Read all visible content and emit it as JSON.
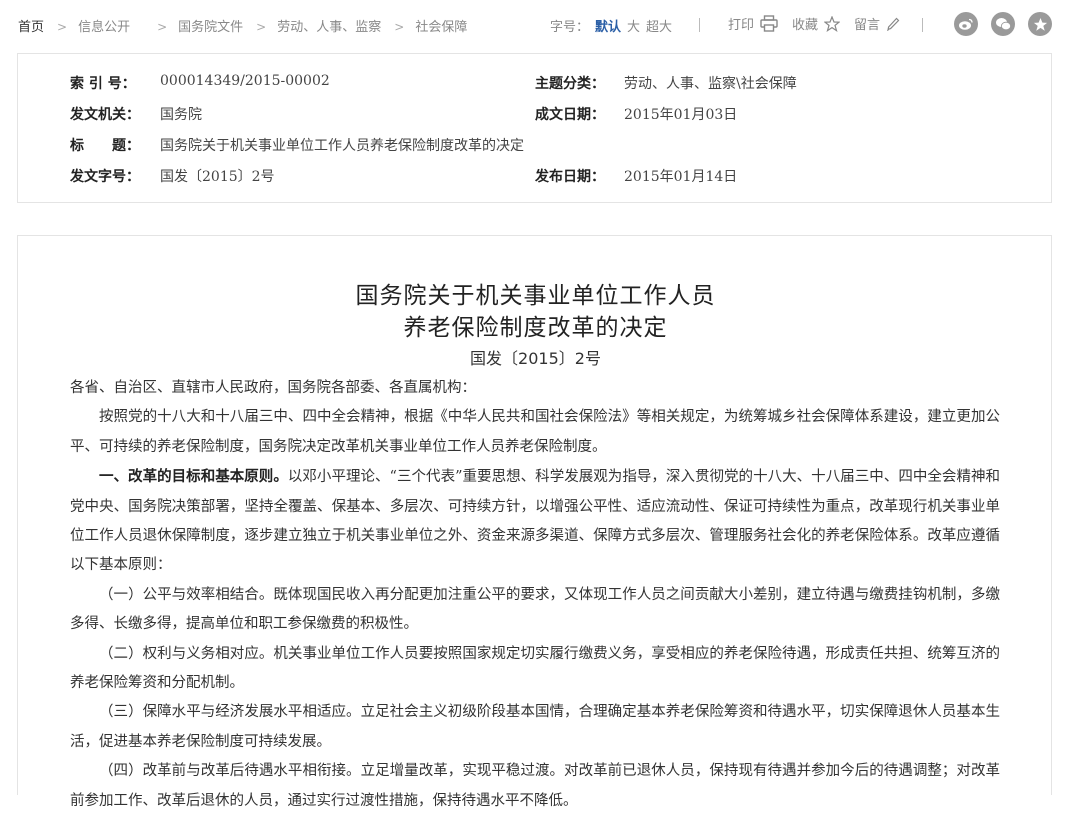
{
  "breadcrumb": {
    "home": "首页",
    "items": [
      "信息公开",
      "国务院文件",
      "劳动、人事、监察",
      "社会保障"
    ]
  },
  "font_size": {
    "label": "字号：",
    "options": [
      "默认",
      "大",
      "超大"
    ],
    "selected": "默认"
  },
  "tools": {
    "print": "打印",
    "favorite": "收藏",
    "comment": "留言"
  },
  "social_icons": [
    "weibo-icon",
    "wechat-icon",
    "star-share-icon"
  ],
  "info": {
    "index_label": "索 引 号：",
    "index_value": "000014349/2015-00002",
    "topic_label": "主题分类：",
    "topic_value": "劳动、人事、监察\\社会保障",
    "issuer_label": "发文机关：",
    "issuer_value": "国务院",
    "date_label": "成文日期：",
    "date_value": "2015年01月03日",
    "title_label": "标　　题：",
    "title_value": "国务院关于机关事业单位工作人员养老保险制度改革的决定",
    "docno_label": "发文字号：",
    "docno_value": "国发〔2015〕2号",
    "pubdate_label": "发布日期：",
    "pubdate_value": "2015年01月14日"
  },
  "article": {
    "title_line1": "国务院关于机关事业单位工作人员",
    "title_line2": "养老保险制度改革的决定",
    "doc_number": "国发〔2015〕2号",
    "salutation": "各省、自治区、直辖市人民政府，国务院各部委、各直属机构：",
    "p1": "按照党的十八大和十八届三中、四中全会精神，根据《中华人民共和国社会保险法》等相关规定，为统筹城乡社会保障体系建设，建立更加公平、可持续的养老保险制度，国务院决定改革机关事业单位工作人员养老保险制度。",
    "p2_head": "一、改革的目标和基本原则。",
    "p2_body": "以邓小平理论、“三个代表”重要思想、科学发展观为指导，深入贯彻党的十八大、十八届三中、四中全会精神和党中央、国务院决策部署，坚持全覆盖、保基本、多层次、可持续方针，以增强公平性、适应流动性、保证可持续性为重点，改革现行机关事业单位工作人员退休保障制度，逐步建立独立于机关事业单位之外、资金来源多渠道、保障方式多层次、管理服务社会化的养老保险体系。改革应遵循以下基本原则：",
    "p3": "（一）公平与效率相结合。既体现国民收入再分配更加注重公平的要求，又体现工作人员之间贡献大小差别，建立待遇与缴费挂钩机制，多缴多得、长缴多得，提高单位和职工参保缴费的积极性。",
    "p4": "（二）权利与义务相对应。机关事业单位工作人员要按照国家规定切实履行缴费义务，享受相应的养老保险待遇，形成责任共担、统筹互济的养老保险筹资和分配机制。",
    "p5": "（三）保障水平与经济发展水平相适应。立足社会主义初级阶段基本国情，合理确定基本养老保险筹资和待遇水平，切实保障退休人员基本生活，促进基本养老保险制度可持续发展。",
    "p6": "（四）改革前与改革后待遇水平相衔接。立足增量改革，实现平稳过渡。对改革前已退休人员，保持现有待遇并参加今后的待遇调整；对改革前参加工作、改革后退休的人员，通过实行过渡性措施，保持待遇水平不降低。"
  }
}
